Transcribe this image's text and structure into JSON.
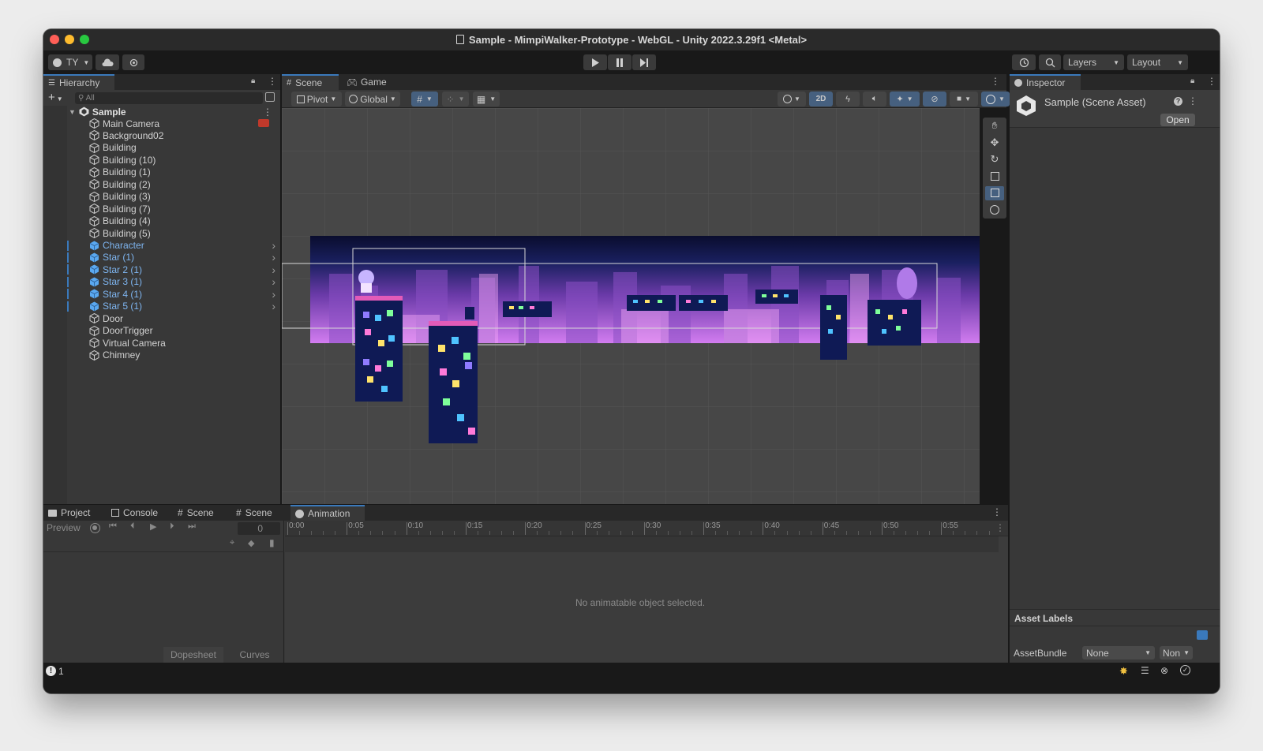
{
  "window": {
    "title": "Sample - MimpiWalker-Prototype - WebGL - Unity 2022.3.29f1 <Metal>",
    "traffic_colors": [
      "#ff5f57",
      "#febc2e",
      "#28c840"
    ]
  },
  "toolbar": {
    "account_label": "TY",
    "layers_label": "Layers",
    "layout_label": "Layout"
  },
  "hierarchy": {
    "tab_label": "Hierarchy",
    "search_placeholder": "All",
    "scene_name": "Sample",
    "items": [
      {
        "label": "Main Camera",
        "prefab": false,
        "expandable": false
      },
      {
        "label": "Background02",
        "prefab": false,
        "expandable": false
      },
      {
        "label": "Building",
        "prefab": false,
        "expandable": false
      },
      {
        "label": "Building (10)",
        "prefab": false,
        "expandable": false
      },
      {
        "label": "Building (1)",
        "prefab": false,
        "expandable": false
      },
      {
        "label": "Building (2)",
        "prefab": false,
        "expandable": false
      },
      {
        "label": "Building (3)",
        "prefab": false,
        "expandable": false
      },
      {
        "label": "Building (7)",
        "prefab": false,
        "expandable": false
      },
      {
        "label": "Building (4)",
        "prefab": false,
        "expandable": false
      },
      {
        "label": "Building (5)",
        "prefab": false,
        "expandable": false
      },
      {
        "label": "Character",
        "prefab": true,
        "expandable": true
      },
      {
        "label": "Star (1)",
        "prefab": true,
        "expandable": true
      },
      {
        "label": "Star 2 (1)",
        "prefab": true,
        "expandable": true
      },
      {
        "label": "Star 3 (1)",
        "prefab": true,
        "expandable": true
      },
      {
        "label": "Star 4 (1)",
        "prefab": true,
        "expandable": true
      },
      {
        "label": "Star 5 (1)",
        "prefab": true,
        "expandable": true
      },
      {
        "label": "Door",
        "prefab": false,
        "expandable": false
      },
      {
        "label": "DoorTrigger",
        "prefab": false,
        "expandable": false
      },
      {
        "label": "Virtual Camera",
        "prefab": false,
        "expandable": false
      },
      {
        "label": "Chimney",
        "prefab": false,
        "expandable": false
      }
    ]
  },
  "scene_tabs": {
    "scene_label": "Scene",
    "game_label": "Game"
  },
  "scene_toolbar": {
    "pivot_label": "Pivot",
    "global_label": "Global",
    "mode_2d_label": "2D"
  },
  "inspector": {
    "tab_label": "Inspector",
    "asset_title": "Sample (Scene Asset)",
    "open_label": "Open",
    "asset_labels_title": "Asset Labels",
    "asset_bundle_label": "AssetBundle",
    "asset_bundle_value": "None",
    "asset_variant_value": "Non"
  },
  "bottom_tabs": {
    "project_label": "Project",
    "console_label": "Console",
    "scene1_label": "Scene",
    "scene2_label": "Scene",
    "animation_label": "Animation"
  },
  "animation": {
    "preview_label": "Preview",
    "frame_value": "0",
    "ruler_labels": [
      "0:00",
      "0:05",
      "0:10",
      "0:15",
      "0:20",
      "0:25",
      "0:30",
      "0:35",
      "0:40",
      "0:45",
      "0:50",
      "0:55"
    ],
    "empty_message": "No animatable object selected.",
    "dopesheet_label": "Dopesheet",
    "curves_label": "Curves"
  },
  "statusbar": {
    "console_count": "1"
  },
  "colors": {
    "accent": "#3a79bb",
    "prefab_text": "#7eb5f0",
    "sky_top": "#0a0d2e",
    "sky_bottom": "#d27cf0"
  }
}
